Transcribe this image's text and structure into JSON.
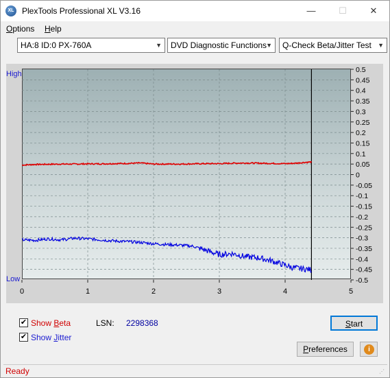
{
  "window": {
    "title": "PlexTools Professional XL V3.16",
    "icon_text": "XL",
    "controls": {
      "minimize": "—",
      "maximize": "☐",
      "close": "✕"
    }
  },
  "menu": {
    "options": {
      "accel": "O",
      "rest": "ptions"
    },
    "help": {
      "accel": "H",
      "rest": "elp"
    }
  },
  "toolbar": {
    "drive": "HA:8 ID:0  PX-760A",
    "function": "DVD Diagnostic Functions",
    "test": "Q-Check Beta/Jitter Test",
    "arrow": "▼"
  },
  "chart_data": {
    "type": "line",
    "label_high": "High",
    "label_low": "Low",
    "x_ticks": [
      "0",
      "1",
      "2",
      "3",
      "4",
      "5"
    ],
    "xlim": [
      0,
      5
    ],
    "y_ticks": [
      "0.5",
      "0.45",
      "0.4",
      "0.35",
      "0.3",
      "0.25",
      "0.2",
      "0.15",
      "0.1",
      "0.05",
      "0",
      "-0.05",
      "-0.1",
      "-0.15",
      "-0.2",
      "-0.25",
      "-0.3",
      "-0.35",
      "-0.4",
      "-0.45",
      "-0.5"
    ],
    "ylim": [
      -0.5,
      0.5
    ],
    "end_marker_x": 4.4,
    "grid": true,
    "series": [
      {
        "color": "#e00000",
        "x": [
          0,
          0.2,
          0.4,
          0.6,
          0.8,
          1.0,
          1.2,
          1.4,
          1.6,
          1.8,
          2.0,
          2.2,
          2.4,
          2.6,
          2.8,
          3.0,
          3.2,
          3.4,
          3.6,
          3.8,
          4.0,
          4.1,
          4.2,
          4.3,
          4.4
        ],
        "values": [
          0.045,
          0.048,
          0.049,
          0.05,
          0.05,
          0.051,
          0.051,
          0.052,
          0.053,
          0.055,
          0.05,
          0.05,
          0.05,
          0.051,
          0.052,
          0.052,
          0.054,
          0.055,
          0.054,
          0.053,
          0.052,
          0.053,
          0.055,
          0.058,
          0.06
        ]
      },
      {
        "color": "#0000e0",
        "x": [
          0,
          0.2,
          0.4,
          0.6,
          0.8,
          1.0,
          1.2,
          1.4,
          1.6,
          1.8,
          2.0,
          2.2,
          2.4,
          2.6,
          2.8,
          3.0,
          3.2,
          3.4,
          3.6,
          3.8,
          4.0,
          4.1,
          4.2,
          4.3,
          4.4
        ],
        "values": [
          -0.31,
          -0.312,
          -0.305,
          -0.31,
          -0.302,
          -0.305,
          -0.31,
          -0.315,
          -0.318,
          -0.322,
          -0.328,
          -0.332,
          -0.335,
          -0.34,
          -0.36,
          -0.38,
          -0.375,
          -0.39,
          -0.395,
          -0.41,
          -0.43,
          -0.44,
          -0.445,
          -0.448,
          -0.452
        ]
      }
    ]
  },
  "controls": {
    "show_beta": {
      "check": "✔",
      "pre": "Show ",
      "accel": "B",
      "post": "eta"
    },
    "show_jitter": {
      "check": "✔",
      "pre": "Show ",
      "accel": "J",
      "post": "itter"
    },
    "lsn_label": "LSN:",
    "lsn_value": "2298368",
    "start_label": {
      "accel": "S",
      "rest": "tart"
    },
    "prefs_label": {
      "accel": "P",
      "rest": "references"
    },
    "info_icon_text": "i"
  },
  "status": {
    "text": "Ready",
    "grip": "⋰"
  },
  "colors": {
    "beta": "#e00000",
    "jitter": "#0000e0",
    "axis_text_blue": "#1a1ad0",
    "accent": "#0078d7"
  }
}
